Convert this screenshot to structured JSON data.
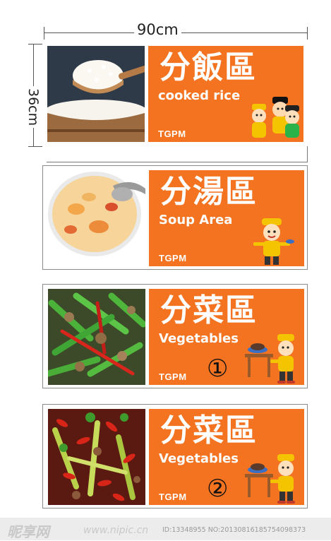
{
  "dimensions": {
    "width_label": "90cm",
    "height_label": "36cm"
  },
  "signs": [
    {
      "title": "分飯區",
      "subtitle": "cooked rice",
      "brand": "TGPM",
      "number": "",
      "photo": "cooked-rice-photo",
      "mascot": "three-chefs-mascot"
    },
    {
      "title": "分湯區",
      "subtitle": "Soup Area",
      "brand": "TGPM",
      "number": "",
      "photo": "soup-bowl-photo",
      "mascot": "chef-serving-mascot"
    },
    {
      "title": "分菜區",
      "subtitle": "Vegetables",
      "brand": "TGPM",
      "number": "①",
      "photo": "green-bean-stirfry-photo",
      "mascot": "chef-at-table-mascot"
    },
    {
      "title": "分菜區",
      "subtitle": "Vegetables",
      "brand": "TGPM",
      "number": "②",
      "photo": "chili-stirfry-photo",
      "mascot": "chef-at-table-mascot"
    }
  ],
  "watermark": {
    "logo": "昵享网",
    "url": "www.nipic.cn",
    "id_text": "ID:13348955 NO:20130816185754098373"
  },
  "colors": {
    "panel": "#f37321",
    "card_border": "#8a8a8a"
  }
}
